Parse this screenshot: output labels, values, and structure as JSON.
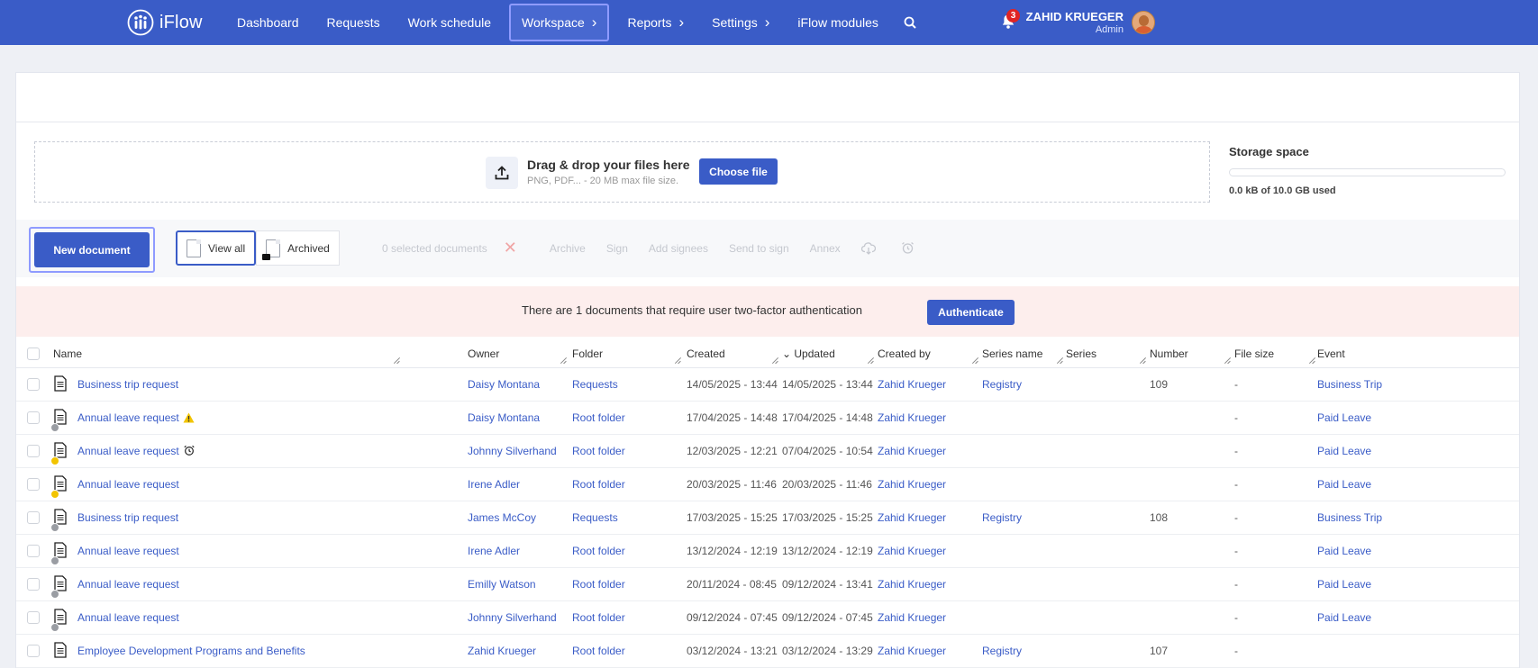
{
  "app": {
    "name": "iFlow"
  },
  "nav": [
    {
      "label": "Dashboard",
      "chevron": false,
      "active": false
    },
    {
      "label": "Requests",
      "chevron": false,
      "active": false
    },
    {
      "label": "Work schedule",
      "chevron": false,
      "active": false
    },
    {
      "label": "Workspace",
      "chevron": true,
      "active": true
    },
    {
      "label": "Reports",
      "chevron": true,
      "active": false
    },
    {
      "label": "Settings",
      "chevron": true,
      "active": false
    },
    {
      "label": "iFlow modules",
      "chevron": false,
      "active": false
    }
  ],
  "notifications": {
    "count": "3"
  },
  "user": {
    "name": "ZAHID KRUEGER",
    "role": "Admin"
  },
  "upload": {
    "title": "Drag & drop your files here",
    "subtitle": "PNG, PDF... - 20 MB max file size.",
    "button": "Choose file"
  },
  "storage": {
    "title": "Storage space",
    "used_text": "0.0 kB of 10.0 GB used",
    "used_fraction": 0
  },
  "toolbar": {
    "new_document": "New document",
    "view_all": "View all",
    "archived": "Archived",
    "selected": "0 selected documents",
    "actions": [
      "Archive",
      "Sign",
      "Add signees",
      "Send to sign",
      "Annex"
    ]
  },
  "auth": {
    "message": "There are 1 documents that require user two-factor authentication",
    "button": "Authenticate"
  },
  "table": {
    "columns": [
      "Name",
      "Owner",
      "Folder",
      "Created",
      "Updated",
      "Created by",
      "Series name",
      "Series",
      "Number",
      "File size",
      "Event"
    ],
    "sorted_column": "Updated",
    "rows": [
      {
        "name": "Business trip request",
        "owner": "Daisy Montana",
        "folder": "Requests",
        "created": "14/05/2025 - 13:44",
        "updated": "14/05/2025 - 13:44",
        "created_by": "Zahid Krueger",
        "series_name": "Registry",
        "series": "",
        "number": "109",
        "file_size": "-",
        "event": "Business Trip",
        "status": "none",
        "flag": "none"
      },
      {
        "name": "Annual leave request",
        "owner": "Daisy Montana",
        "folder": "Root folder",
        "created": "17/04/2025 - 14:48",
        "updated": "17/04/2025 - 14:48",
        "created_by": "Zahid Krueger",
        "series_name": "",
        "series": "",
        "number": "",
        "file_size": "-",
        "event": "Paid Leave",
        "status": "grey",
        "flag": "warning"
      },
      {
        "name": "Annual leave request",
        "owner": "Johnny Silverhand",
        "folder": "Root folder",
        "created": "12/03/2025 - 12:21",
        "updated": "07/04/2025 - 10:54",
        "created_by": "Zahid Krueger",
        "series_name": "",
        "series": "",
        "number": "",
        "file_size": "-",
        "event": "Paid Leave",
        "status": "yellow",
        "flag": "alarm"
      },
      {
        "name": "Annual leave request",
        "owner": "Irene Adler",
        "folder": "Root folder",
        "created": "20/03/2025 - 11:46",
        "updated": "20/03/2025 - 11:46",
        "created_by": "Zahid Krueger",
        "series_name": "",
        "series": "",
        "number": "",
        "file_size": "-",
        "event": "Paid Leave",
        "status": "yellow",
        "flag": "none"
      },
      {
        "name": "Business trip request",
        "owner": "James McCoy",
        "folder": "Requests",
        "created": "17/03/2025 - 15:25",
        "updated": "17/03/2025 - 15:25",
        "created_by": "Zahid Krueger",
        "series_name": "Registry",
        "series": "",
        "number": "108",
        "file_size": "-",
        "event": "Business Trip",
        "status": "grey",
        "flag": "none"
      },
      {
        "name": "Annual leave request",
        "owner": "Irene Adler",
        "folder": "Root folder",
        "created": "13/12/2024 - 12:19",
        "updated": "13/12/2024 - 12:19",
        "created_by": "Zahid Krueger",
        "series_name": "",
        "series": "",
        "number": "",
        "file_size": "-",
        "event": "Paid Leave",
        "status": "grey",
        "flag": "none"
      },
      {
        "name": "Annual leave request",
        "owner": "Emilly Watson",
        "folder": "Root folder",
        "created": "20/11/2024 - 08:45",
        "updated": "09/12/2024 - 13:41",
        "created_by": "Zahid Krueger",
        "series_name": "",
        "series": "",
        "number": "",
        "file_size": "-",
        "event": "Paid Leave",
        "status": "grey",
        "flag": "none"
      },
      {
        "name": "Annual leave request",
        "owner": "Johnny Silverhand",
        "folder": "Root folder",
        "created": "09/12/2024 - 07:45",
        "updated": "09/12/2024 - 07:45",
        "created_by": "Zahid Krueger",
        "series_name": "",
        "series": "",
        "number": "",
        "file_size": "-",
        "event": "Paid Leave",
        "status": "grey",
        "flag": "none"
      },
      {
        "name": "Employee Development Programs and Benefits",
        "owner": "Zahid Krueger",
        "folder": "Root folder",
        "created": "03/12/2024 - 13:21",
        "updated": "03/12/2024 - 13:29",
        "created_by": "Zahid Krueger",
        "series_name": "Registry",
        "series": "",
        "number": "107",
        "file_size": "-",
        "event": "",
        "status": "none",
        "flag": "none"
      }
    ]
  },
  "colors": {
    "primary": "#3a5cc7",
    "link": "#3a5cc7",
    "auth_bg": "#fdeeed",
    "badge": "#e02424"
  }
}
